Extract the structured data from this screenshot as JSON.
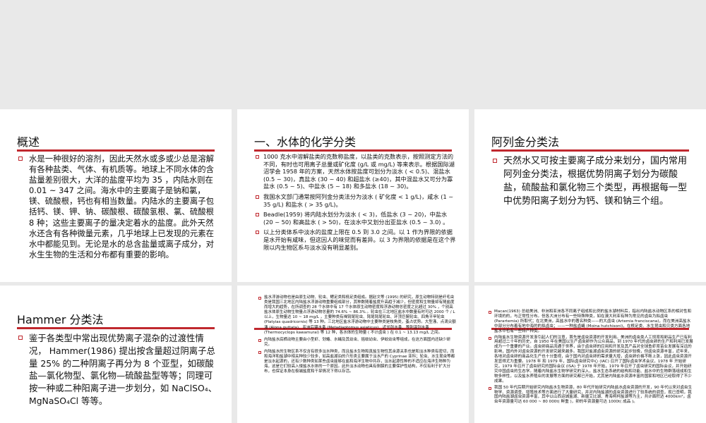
{
  "colors": {
    "accent": "#c0282e",
    "background": "#e9e9e9",
    "slide": "#ffffff"
  },
  "slides": [
    {
      "title": "概述",
      "paragraphs": [
        "水是一种很好的溶剂，因此天然水或多或少总是溶解有各种盐类、气体、有机质等。地球上不同水体的含盐量差别很大，大洋的盐度平均为 35 ，内陆水则在 0.01 ~ 347 之间。海水中的主要离子是钠和氯，镁、硫酸根，钙也有相当数量。内陆水的主要离子包括钙、镁、钾、钠、碳酸根、碳酸氢根、氯、硫酸根 8 种；这些主要离子的量决定着水的盐度。此外天然水还含有各种微量元素，几乎地球上已发现的元素在水中都能见到。无论是水的总含盐量或离子成分，对水生生物的生活和分布都有重要的影响。"
      ]
    },
    {
      "title": "一、水体的化学分类",
      "paragraphs": [
        "1000 克水中溶解盐类的克数称盐度，以盐类的克数表示，按照测定方法的不同，有时也可用离子总量或矿化度 (g/L 或 mg/L) 等来表示。根据国际湖沼学会 1958 年的方案，天然水体按盐度可划分为淡水 ( < 0.5)、混盐水 (0.5 ~ 30)，真盐水 (30 ~ 40) 和超盐水 (≥40)，其中混盐水又可分为寡盐水 (0.5 ~ 5)、中盐水 (5 ~ 18) 和多盐水 (18 ~ 30)。",
        "我国水文部门通常按阿列金分类法分为淡水 ( 矿化度 < 1 g/L)，咸水 (1 ~ 35 g/L) 和盐水 ( > 35 g/L)。",
        "Beadle(1959) 将内陆水划分为淡水 ( < 3)，低盐水 (3 ~ 20)，中盐水 (20 ~ 50) 和高盐水 ( > 50)，在淡水中又划分出亚盐水 (0.5 ~ 3.0) 。",
        "以上分类体系中淡水的盐度上限在 0.5 到 3.0 之间。以 1 作为界限的依据是水开始有咸味，但这因人的味觉而有差异。以 3 为界限的依据是在这个界限以内生物区系与淡水没有明显差别。"
      ]
    },
    {
      "title": "阿列金分类法",
      "paragraphs": [
        "天然水又可按主要离子成分来划分，国内常用阿列金分类法，根据优势阴离子划分为碳酸盐，硫酸盐和氯化物三个类型，再根据每一型中优势阳离子划分为钙、镁和钠三个组。"
      ]
    },
    {
      "title": "Hammer 分类法",
      "paragraphs": [
        "鉴于各类型中常出现优势离子混杂的过渡性情况， Hammer(1986) 提出按含量超过阴离子总量 25% 的二种阴离子再分为 8 个亚型，如碳酸盐—氯化物型、氯化物—硫酸盐型等等；同理可按一种或二种阳离子进一步划分，如 NaClSO₄、 MgNaSO₄Cl 等等。"
      ]
    },
    {
      "title": "",
      "paragraphs": [
        "盐水浮游动物也是由原生动物、轮虫、鳃足类和桡足类组成。据赵文等 (1995) 的研究，原生动物特别是纤毛虫类是我国三北地区内陆盐水浮游动物重要组成部分，其种数随着盐度升高趋于减少，但密度和生物量却有随盐度而增大的趋势，在所调查的 28 个水体中有 17 个水体原生动物密度和浮游动物总密度之比超过 30% ，个别高盐水体原生动物生物量占浮游动物总量的 74.6% ~ 86.3% 。轮虫在三北地区盐水中数量有时可达 2000 个 / L 以上，生物量达 10 ~ 18 mg/L ，主要种类有褐臂尾轮虫、臂尾臂尾轮虫、环顶巨腕轮虫、四角平甲轮虫 (Platyias quadricornis) 等 13 种。三北地区盐水浮游动物中主要种类是枝角类，蚤占优势。大型溞、点滴尖额溞 (Alona guttata)、亚洲后镖水蚤 (Metadiaptomus asiaticus)、近邻剑水蚤、等刺温剑水蚤 (Thermocyclops kawamurai) 等 12 种，各水体的生物量 ( 不计卤虫 ) 在 0.1 ~ 13.13 mg/L 之间。",
        "内陆盐水底栖动物主要由小型虾、划蝽、水蝇及其幼虫、摇蚊幼虫、伊蚊幼虫等组成，在这方面国内还缺少研究。",
        "内陆盐水的生物区系不仅含有很多淡水种类，而且盐水生物和真盐生物性其余源关系也是和淡水种类有密切，而和海洋和盐湖中相关种较少较多，如高盐湖泊的介形类主要属于淡水产的 Cyprinae 亚科；轮虫、水生昆虫等都是淡水起源的，还有少数种类如某些卤虫能够在盐和海洋生物中共存，淡水起源性种的不适应在海洋生物种为海，这是它们较高入侵盐水水体的一个原因。此外淡水动物也具有侧膜的主要保护性结构，不仅有利于扩大分布，也保证本身在极端盐度和干旱情况下得以存活。"
      ]
    },
    {
      "title": "",
      "paragraphs": [
        "Macan(1963) 总结美洲、非洲和亚洲各不同离子组成和比例的盐水湖材料后，指出内陆盐水动物区系的相对性和环境的的，与正常性分布。但各大洲分布有一些特殊种类，如在澳大利亚有种为常见的卤虫为拟卤虫 (Parartemia) 所取代；在北美洲，高盐水中的著名种类——的大卤虫 (Artemia franciscana)，而在美洲高盐水中部分分布着有地中海的的拟卤虫；——一种盐卤蝇 (Moina hutchisoni)，在根足类、水生昆虫和贝类方面各地盐水中也有一些特产种类。",
        "内陆盐水生物资源开发渐引起人们的注意，首先是卤虫资源的开发利用。美洲的卤虫类人工饲育和卵品生产已有利用超过二十年的历史，自 1950 年在美国以生产卤虫卵作为公众商品，到 1970 年代的卤虫卵的生产和利用已发展成为一个重要的产业。卤虫卵商品流通于世界，由于卤虫卵的应用和开发及其产品对全球鱼虾育苗业发展有深远的影响，国内外对卤虫资源的开发研究越来越多。我国对盐湖卤虫资源的研究起步较晚，但卤虫资源丰富，近年来，各地对卤虫卵的商品化生产也十分重视，由于国内对卤虫卵的需求量大增，卤虫卵价格不断上涨，因此卤虫资源开发显得尤为重要。1978 年 和 1979 年，国际卤虫研究中心 (IAC) 召开了国际卤虫学术会议，1978 年 开始研究，1979 年召开了卤虫研究的国际会议 (ISA) 于 1978 年开始，1979 年召开了卤虫研究的国际会议，并开始研究中国卤虫的生态学。随着内陆盐水生物学研究的深入，盐水生态系统的结构和功能、盐水中的生物群落组成和生物多样性，以及盐水养殖业的发展等方面的研究都已开始，尤其是内陆盐水资源丰富的国家和地区已经取得了不少成果。",
        "我国 50 年代后期开始研究内陆盐水生物资源，80 年代开始研究内陆盐水卤虫资源的开发，90 年代以来对卤虫生物学、资源调查、增殖技术等方面进行了大量研究，并对内陆盐湖的卤虫资源进行了较系统的调查，现已查明，我国内陆盐湖卤虫资源丰富，其中以山西运城盐湖、新疆艾比湖、青海柯柯盐湖等为主，共计面积达 4000km²，卤虫年资源量可达 60 000 ~ 80 000t( 鲜重 )，卵的年资源量可达 1000t( 成品 )。"
      ]
    }
  ]
}
